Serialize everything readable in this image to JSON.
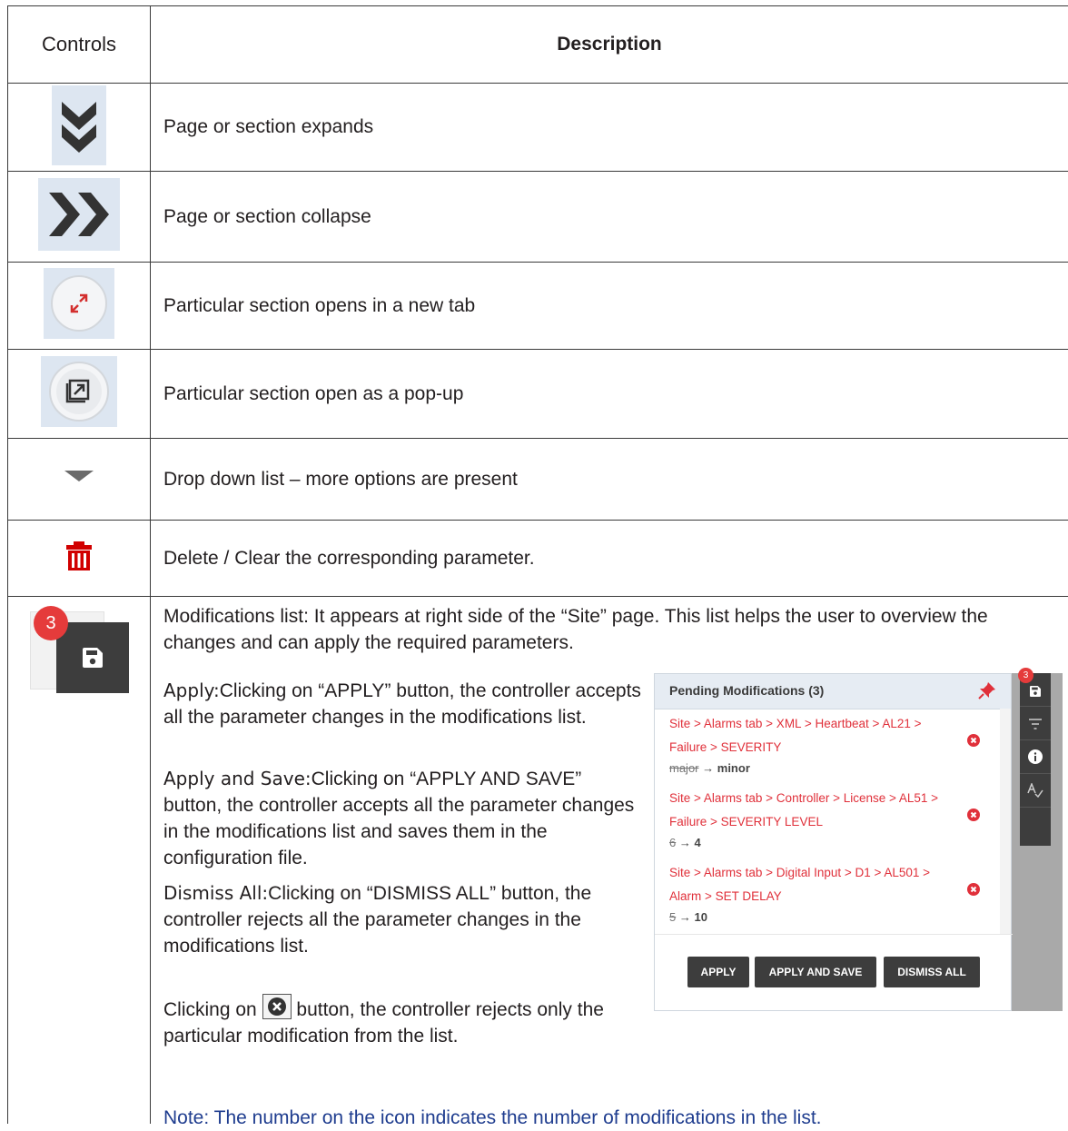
{
  "table": {
    "header_controls": "Controls",
    "header_description": "Description"
  },
  "rows": [
    {
      "icon": "double-chevron-down-icon",
      "description": "Page or section expands"
    },
    {
      "icon": "double-chevron-right-icon",
      "description": "Page or section collapse"
    },
    {
      "icon": "open-new-tab-icon",
      "description": "Particular section opens in a new tab"
    },
    {
      "icon": "open-popup-icon",
      "description": "Particular section open as a pop-up"
    },
    {
      "icon": "dropdown-triangle-icon",
      "description": "Drop down list – more options are present"
    },
    {
      "icon": "trash-icon",
      "description": "Delete / Clear the corresponding parameter."
    }
  ],
  "modifications": {
    "icon": "save-icon",
    "badge_count": "3",
    "intro_bold": "Modifications list",
    "intro_text": ": It appears at right side of the “Site” page. This list helps the user to overview the changes and can apply the required parameters.",
    "apply_label": "Apply:",
    "apply_text": "Clicking on “APPLY” button, the controller accepts all the parameter changes in the modifications list.",
    "apply_save_label": "Apply and Save:",
    "apply_save_text": "Clicking on “APPLY AND SAVE” button, the controller accepts all the parameter changes in the modifications list and saves them in the configuration file.",
    "dismiss_label": "Dismiss All:",
    "dismiss_text": "Clicking on “DISMISS ALL” button, the controller rejects all the parameter changes in the modifications list.",
    "clicking_prefix": "Clicking on",
    "clicking_suffix": "button, the controller rejects only the particular modification from the list.",
    "note": "Note: The number on the icon indicates the number of modifications in the list."
  },
  "pending_panel": {
    "title": "Pending Modifications (3)",
    "rail_badge": "3",
    "items": [
      {
        "path_line1": "Site > Alarms tab > XML > Heartbeat > AL21 >",
        "path_line2": "Failure > SEVERITY",
        "old": "major",
        "arrow": "→",
        "new": "minor"
      },
      {
        "path_line1": "Site > Alarms tab > Controller > License > AL51 >",
        "path_line2": "Failure > SEVERITY LEVEL",
        "old": "6",
        "arrow": "→",
        "new": "4"
      },
      {
        "path_line1": "Site > Alarms tab > Digital Input > D1 > AL501 >",
        "path_line2": "Alarm > SET DELAY",
        "old": "5",
        "arrow": "→",
        "new": "10"
      }
    ],
    "buttons": [
      "APPLY",
      "APPLY AND SAVE",
      "DISMISS ALL"
    ]
  },
  "colors": {
    "note_blue": "#1f3d8f",
    "badge_red": "#e53b3b",
    "path_red": "#e0303a",
    "icon_dark": "#3d3d3d"
  }
}
